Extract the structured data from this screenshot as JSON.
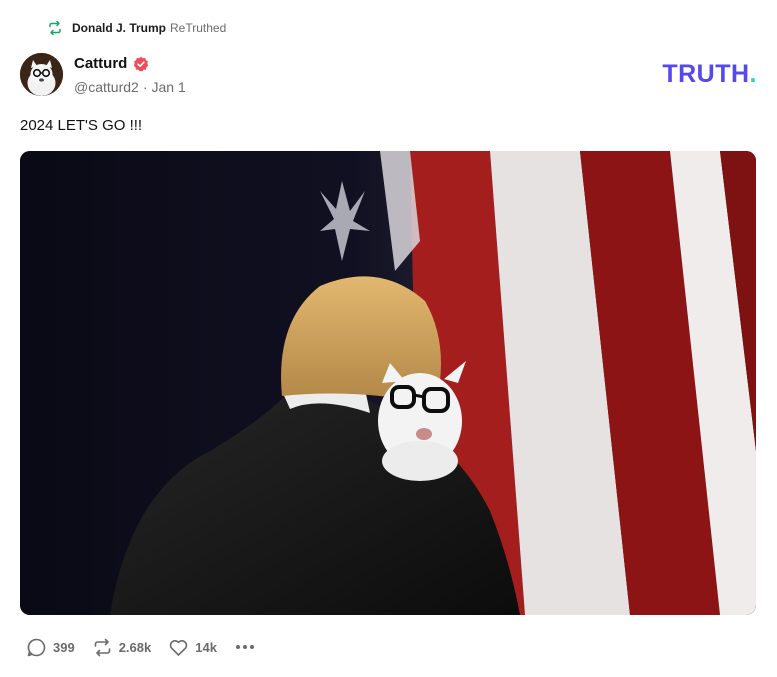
{
  "retruth": {
    "user": "Donald J. Trump",
    "verb": "ReTruthed",
    "icon": "retruth-icon"
  },
  "author": {
    "display_name": "Catturd",
    "handle": "@catturd2",
    "separator": "·",
    "date": "Jan 1",
    "verified_icon": "verified-badge-icon",
    "verified_color": "#ee4c5b"
  },
  "brand": {
    "word": "TRUTH",
    "dot": ".",
    "color": "#5448ee",
    "dot_color": "#2ad2c1"
  },
  "post": {
    "text": "2024 LET'S GO !!!",
    "media_description_icon": "photo-image"
  },
  "actions": {
    "replies": "399",
    "retruths": "2.68k",
    "likes": "14k",
    "reply_icon": "reply-bubble-icon",
    "retruth_icon": "retruth-icon",
    "like_icon": "heart-icon",
    "more_icon": "more-dots-icon"
  }
}
